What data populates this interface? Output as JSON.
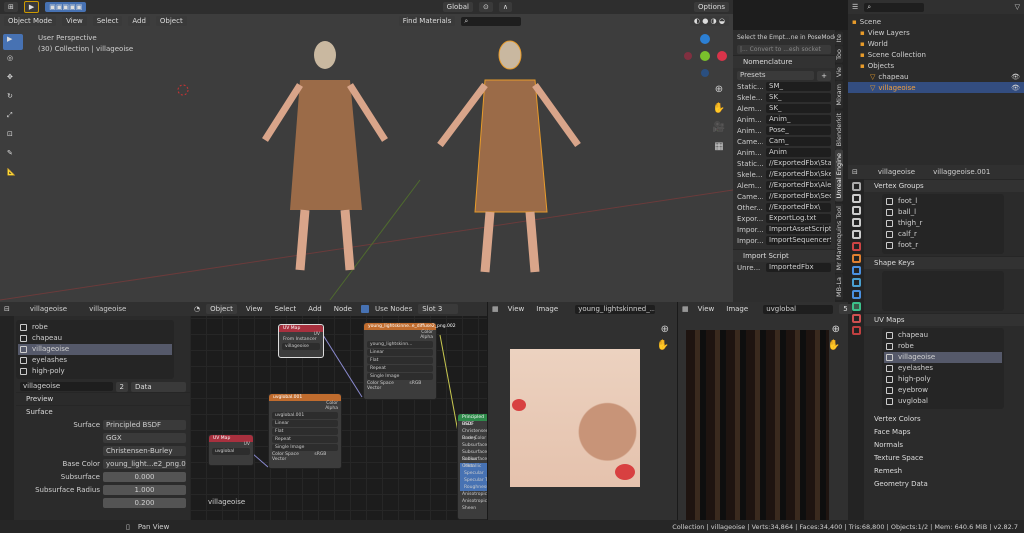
{
  "viewport": {
    "mode": "Object Mode",
    "menus": [
      "View",
      "Select",
      "Add",
      "Object"
    ],
    "orientation": "Global",
    "find_materials": "Find Materials",
    "options": "Options",
    "perspective": "User Perspective",
    "collection": "(30) Collection | villageoise"
  },
  "npanel": {
    "hint": "Select the Empt...ne in PoseMode.",
    "convert": "|... Convert to ...esh socket",
    "nomenclature": "Nomenclature",
    "presets": "Presets",
    "rows": [
      [
        "Static...",
        "SM_"
      ],
      [
        "Skele...",
        "SK_"
      ],
      [
        "Alem...",
        "SK_"
      ],
      [
        "Anim...",
        "Anim_"
      ],
      [
        "Anim...",
        "Pose_"
      ],
      [
        "Came...",
        "Cam_"
      ],
      [
        "Anim...",
        "Anim"
      ],
      [
        "Static...",
        "//ExportedFbx\\Stati..."
      ],
      [
        "Skele...",
        "//ExportedFbx\\Skel..."
      ],
      [
        "Alem...",
        "//ExportedFbx\\Ale..."
      ],
      [
        "Came...",
        "//ExportedFbx\\Sequ..."
      ],
      [
        "Other...",
        "//ExportedFbx\\"
      ],
      [
        "Expor...",
        "ExportLog.txt"
      ],
      [
        "Impor...",
        "ImportAssetScript.py"
      ],
      [
        "Impor...",
        "ImportSequencerSc..."
      ]
    ],
    "import_script": "Import Script",
    "unreal_row": [
      "Unre...",
      "ImportedFbx"
    ],
    "tabs": [
      "Ite",
      "Too",
      "Vie",
      "Mixam",
      "Blenderkit",
      "Unreal Engine",
      "Mr Mannequins Tool",
      "MB-La"
    ]
  },
  "outliner": {
    "items": [
      {
        "label": "Scene"
      },
      {
        "label": "View Layers"
      },
      {
        "label": "World"
      },
      {
        "label": "Scene Collection"
      },
      {
        "label": "Objects"
      },
      {
        "label": "chapeau"
      },
      {
        "label": "villageoise"
      }
    ]
  },
  "properties": {
    "object": "villageoise",
    "mesh": "villaggeoise.001",
    "vertex_groups": "Vertex Groups",
    "groups": [
      "foot_l",
      "ball_l",
      "thigh_r",
      "calf_r",
      "foot_r"
    ],
    "shape_keys": "Shape Keys",
    "uv_maps": "UV Maps",
    "uvs": [
      "chapeau",
      "robe",
      "villageoise",
      "eyelashes",
      "high-poly",
      "eyebrow",
      "uvglobal"
    ],
    "sections": [
      "Vertex Colors",
      "Face Maps",
      "Normals",
      "Texture Space",
      "Remesh",
      "Geometry Data"
    ]
  },
  "material": {
    "object": "villageoise",
    "material": "villageoise",
    "slots": [
      "robe",
      "chapeau",
      "villageoise",
      "eyelashes",
      "high-poly"
    ],
    "name": "villageoise",
    "users": "2",
    "link": "Data",
    "preview": "Preview",
    "surface_section": "Surface",
    "surface_label": "Surface",
    "surface_value": "Principled BSDF",
    "distribution": "GGX",
    "sss_method": "Christensen-Burley",
    "base_color_label": "Base Color",
    "base_color": "young_light...e2_png.002",
    "subsurface_label": "Subsurface",
    "subsurface": "0.000",
    "radius_label": "Subsurface Radius",
    "radius1": "1.000",
    "radius2": "0.200"
  },
  "nodes": {
    "menus": [
      "View",
      "Select",
      "Add",
      "Node"
    ],
    "object": "Object",
    "use_nodes": "Use Nodes",
    "slot": "Slot 3",
    "label": "villageoise",
    "uvmap1": {
      "title": "UV Map",
      "out": "UV",
      "from": "From Instancer",
      "map": "villageoise"
    },
    "imgtex": {
      "title": "young_lightskinne..e_diffuse2_png.002",
      "color": "Color",
      "alpha": "Alpha",
      "img": "young_lightskinn...",
      "opts": [
        "Linear",
        "Flat",
        "Repeat",
        "Single Image"
      ],
      "cs": "Color Space",
      "csv": "sRGB",
      "vec": "Vector"
    },
    "uvglobal": {
      "title": "uvglobal.001",
      "color": "Color",
      "alpha": "Alpha",
      "img": "uvglobal.001",
      "opts": [
        "Linear",
        "Flat",
        "Repeat",
        "Single Image"
      ],
      "cs": "Color Space",
      "csv": "sRGB",
      "vec": "Vector"
    },
    "uvmap2": {
      "title": "UV Map",
      "out": "UV",
      "map": "uvglobal"
    },
    "principled": {
      "title": "Principled BSDF",
      "rows": [
        "GGX",
        "Christensen-Burley",
        "Base Color",
        "Subsurface",
        "Subsurface Radius",
        "Subsurface Color",
        "Metallic",
        "Specular",
        "Specular Tint",
        "Roughness",
        "Anisotropic",
        "Anisotropic Rot",
        "Sheen"
      ]
    }
  },
  "image1": {
    "menus": [
      "View",
      "Image"
    ],
    "image": "young_lightskinned_..."
  },
  "image2": {
    "menus": [
      "View",
      "Image"
    ],
    "image": "uvglobal",
    "users": "5"
  },
  "status": {
    "pan": "Pan View",
    "stats": "Collection | villageoise | Verts:34,864 | Faces:34,400 | Tris:68,800 | Objects:1/2 | Mem: 640.6 MiB | v2.82.7"
  }
}
